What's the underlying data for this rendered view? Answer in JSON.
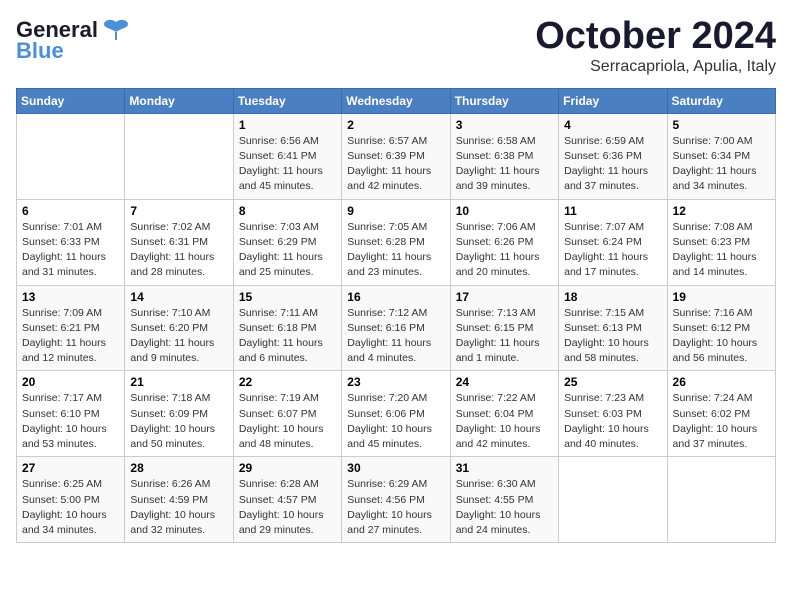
{
  "header": {
    "logo_general": "General",
    "logo_blue": "Blue",
    "month": "October 2024",
    "location": "Serracapriola, Apulia, Italy"
  },
  "weekdays": [
    "Sunday",
    "Monday",
    "Tuesday",
    "Wednesday",
    "Thursday",
    "Friday",
    "Saturday"
  ],
  "weeks": [
    [
      {
        "day": "",
        "sunrise": "",
        "sunset": "",
        "daylight": ""
      },
      {
        "day": "",
        "sunrise": "",
        "sunset": "",
        "daylight": ""
      },
      {
        "day": "1",
        "sunrise": "Sunrise: 6:56 AM",
        "sunset": "Sunset: 6:41 PM",
        "daylight": "Daylight: 11 hours and 45 minutes."
      },
      {
        "day": "2",
        "sunrise": "Sunrise: 6:57 AM",
        "sunset": "Sunset: 6:39 PM",
        "daylight": "Daylight: 11 hours and 42 minutes."
      },
      {
        "day": "3",
        "sunrise": "Sunrise: 6:58 AM",
        "sunset": "Sunset: 6:38 PM",
        "daylight": "Daylight: 11 hours and 39 minutes."
      },
      {
        "day": "4",
        "sunrise": "Sunrise: 6:59 AM",
        "sunset": "Sunset: 6:36 PM",
        "daylight": "Daylight: 11 hours and 37 minutes."
      },
      {
        "day": "5",
        "sunrise": "Sunrise: 7:00 AM",
        "sunset": "Sunset: 6:34 PM",
        "daylight": "Daylight: 11 hours and 34 minutes."
      }
    ],
    [
      {
        "day": "6",
        "sunrise": "Sunrise: 7:01 AM",
        "sunset": "Sunset: 6:33 PM",
        "daylight": "Daylight: 11 hours and 31 minutes."
      },
      {
        "day": "7",
        "sunrise": "Sunrise: 7:02 AM",
        "sunset": "Sunset: 6:31 PM",
        "daylight": "Daylight: 11 hours and 28 minutes."
      },
      {
        "day": "8",
        "sunrise": "Sunrise: 7:03 AM",
        "sunset": "Sunset: 6:29 PM",
        "daylight": "Daylight: 11 hours and 25 minutes."
      },
      {
        "day": "9",
        "sunrise": "Sunrise: 7:05 AM",
        "sunset": "Sunset: 6:28 PM",
        "daylight": "Daylight: 11 hours and 23 minutes."
      },
      {
        "day": "10",
        "sunrise": "Sunrise: 7:06 AM",
        "sunset": "Sunset: 6:26 PM",
        "daylight": "Daylight: 11 hours and 20 minutes."
      },
      {
        "day": "11",
        "sunrise": "Sunrise: 7:07 AM",
        "sunset": "Sunset: 6:24 PM",
        "daylight": "Daylight: 11 hours and 17 minutes."
      },
      {
        "day": "12",
        "sunrise": "Sunrise: 7:08 AM",
        "sunset": "Sunset: 6:23 PM",
        "daylight": "Daylight: 11 hours and 14 minutes."
      }
    ],
    [
      {
        "day": "13",
        "sunrise": "Sunrise: 7:09 AM",
        "sunset": "Sunset: 6:21 PM",
        "daylight": "Daylight: 11 hours and 12 minutes."
      },
      {
        "day": "14",
        "sunrise": "Sunrise: 7:10 AM",
        "sunset": "Sunset: 6:20 PM",
        "daylight": "Daylight: 11 hours and 9 minutes."
      },
      {
        "day": "15",
        "sunrise": "Sunrise: 7:11 AM",
        "sunset": "Sunset: 6:18 PM",
        "daylight": "Daylight: 11 hours and 6 minutes."
      },
      {
        "day": "16",
        "sunrise": "Sunrise: 7:12 AM",
        "sunset": "Sunset: 6:16 PM",
        "daylight": "Daylight: 11 hours and 4 minutes."
      },
      {
        "day": "17",
        "sunrise": "Sunrise: 7:13 AM",
        "sunset": "Sunset: 6:15 PM",
        "daylight": "Daylight: 11 hours and 1 minute."
      },
      {
        "day": "18",
        "sunrise": "Sunrise: 7:15 AM",
        "sunset": "Sunset: 6:13 PM",
        "daylight": "Daylight: 10 hours and 58 minutes."
      },
      {
        "day": "19",
        "sunrise": "Sunrise: 7:16 AM",
        "sunset": "Sunset: 6:12 PM",
        "daylight": "Daylight: 10 hours and 56 minutes."
      }
    ],
    [
      {
        "day": "20",
        "sunrise": "Sunrise: 7:17 AM",
        "sunset": "Sunset: 6:10 PM",
        "daylight": "Daylight: 10 hours and 53 minutes."
      },
      {
        "day": "21",
        "sunrise": "Sunrise: 7:18 AM",
        "sunset": "Sunset: 6:09 PM",
        "daylight": "Daylight: 10 hours and 50 minutes."
      },
      {
        "day": "22",
        "sunrise": "Sunrise: 7:19 AM",
        "sunset": "Sunset: 6:07 PM",
        "daylight": "Daylight: 10 hours and 48 minutes."
      },
      {
        "day": "23",
        "sunrise": "Sunrise: 7:20 AM",
        "sunset": "Sunset: 6:06 PM",
        "daylight": "Daylight: 10 hours and 45 minutes."
      },
      {
        "day": "24",
        "sunrise": "Sunrise: 7:22 AM",
        "sunset": "Sunset: 6:04 PM",
        "daylight": "Daylight: 10 hours and 42 minutes."
      },
      {
        "day": "25",
        "sunrise": "Sunrise: 7:23 AM",
        "sunset": "Sunset: 6:03 PM",
        "daylight": "Daylight: 10 hours and 40 minutes."
      },
      {
        "day": "26",
        "sunrise": "Sunrise: 7:24 AM",
        "sunset": "Sunset: 6:02 PM",
        "daylight": "Daylight: 10 hours and 37 minutes."
      }
    ],
    [
      {
        "day": "27",
        "sunrise": "Sunrise: 6:25 AM",
        "sunset": "Sunset: 5:00 PM",
        "daylight": "Daylight: 10 hours and 34 minutes."
      },
      {
        "day": "28",
        "sunrise": "Sunrise: 6:26 AM",
        "sunset": "Sunset: 4:59 PM",
        "daylight": "Daylight: 10 hours and 32 minutes."
      },
      {
        "day": "29",
        "sunrise": "Sunrise: 6:28 AM",
        "sunset": "Sunset: 4:57 PM",
        "daylight": "Daylight: 10 hours and 29 minutes."
      },
      {
        "day": "30",
        "sunrise": "Sunrise: 6:29 AM",
        "sunset": "Sunset: 4:56 PM",
        "daylight": "Daylight: 10 hours and 27 minutes."
      },
      {
        "day": "31",
        "sunrise": "Sunrise: 6:30 AM",
        "sunset": "Sunset: 4:55 PM",
        "daylight": "Daylight: 10 hours and 24 minutes."
      },
      {
        "day": "",
        "sunrise": "",
        "sunset": "",
        "daylight": ""
      },
      {
        "day": "",
        "sunrise": "",
        "sunset": "",
        "daylight": ""
      }
    ]
  ]
}
